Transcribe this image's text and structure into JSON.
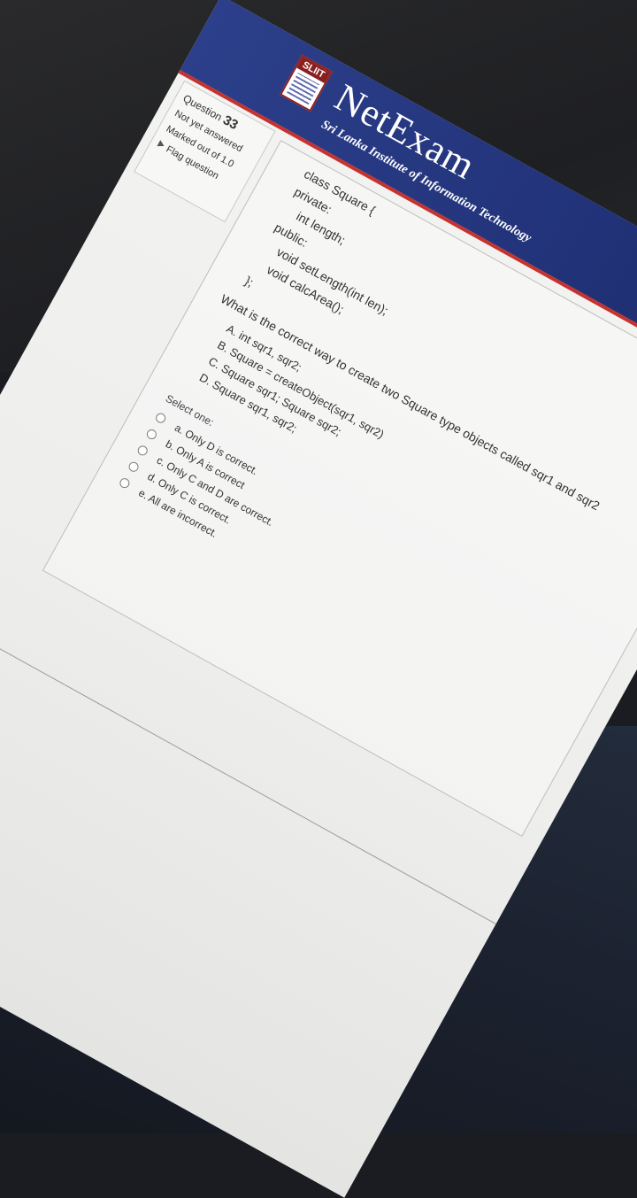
{
  "header": {
    "logo_text": "SLIIT",
    "brand": "NetExam",
    "subtitle": "Sri Lanka Institute of Information Technology"
  },
  "question_info": {
    "label": "Question",
    "number": "33",
    "status": "Not yet answered",
    "marks": "Marked out of 1.0",
    "flag_label": "Flag question"
  },
  "code_lines": [
    "class Square {",
    "private:",
    "    int length;",
    "public:",
    "    void setLength(int len);",
    "    void calcArea();",
    "};"
  ],
  "question_text": "What is the correct way to create two Square type objects called sqr1 and sqr2",
  "statements": [
    "A. int sqr1, sqr2;",
    "B. Square = createObject(sqr1, sqr2)",
    "C. Square sqr1; Square sqr2;",
    "D. Square sqr1, sqr2;"
  ],
  "select_label": "Select one:",
  "options": [
    "a. Only D is correct.",
    "b. Only A is correct",
    "c. Only C and D are correct.",
    "d. Only C is correct.",
    "e. All are incorrect."
  ]
}
